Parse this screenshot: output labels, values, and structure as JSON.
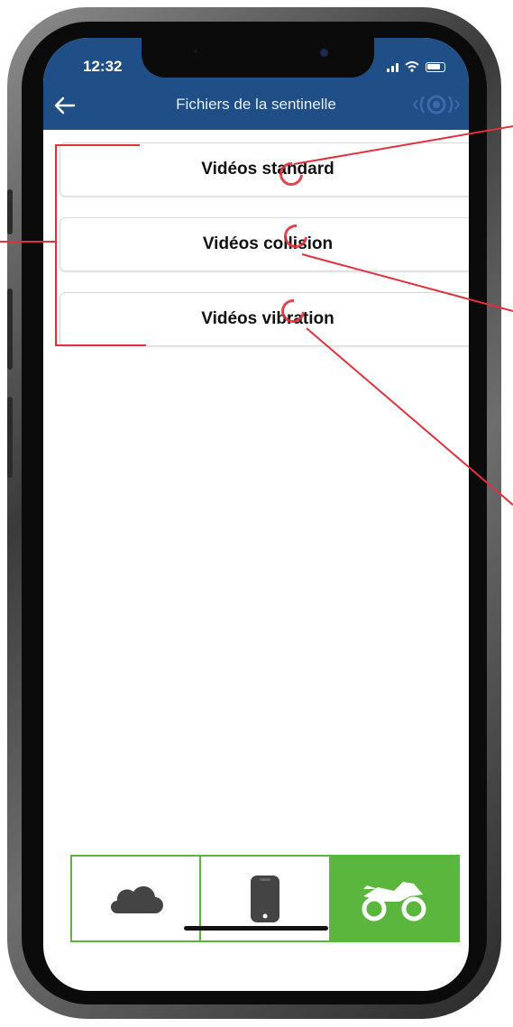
{
  "status_bar": {
    "time": "12:32"
  },
  "header": {
    "title": "Fichiers de la sentinelle",
    "back_icon": "arrow-left-icon",
    "sentinel_icon": "sentinel-signal-icon"
  },
  "video_buttons": [
    {
      "label": "Vidéos standard"
    },
    {
      "label": "Vidéos collision"
    },
    {
      "label": "Vidéos vibration"
    }
  ],
  "tab_bar": {
    "tabs": [
      {
        "icon": "cloud-icon",
        "active": false
      },
      {
        "icon": "phone-icon",
        "active": false
      },
      {
        "icon": "motorcycle-icon",
        "active": true
      }
    ]
  },
  "colors": {
    "header": "#1f4f86",
    "accent": "#5bb63e",
    "annotation": "#e0313c",
    "dark_icon": "#444444"
  }
}
